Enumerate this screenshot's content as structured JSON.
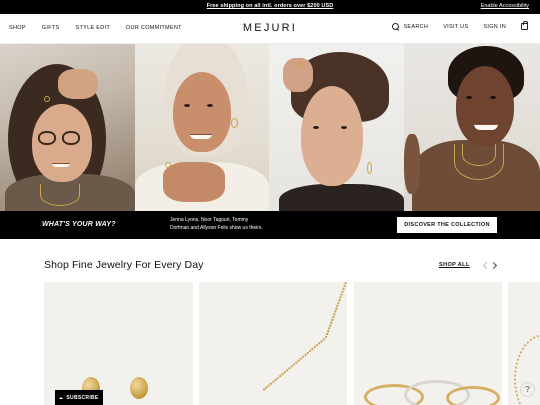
{
  "announcement": {
    "message": "Free shipping on all intl. orders over $200 USD",
    "accessibility_link": "Enable Accessibility"
  },
  "header": {
    "logo": "MEJURI",
    "nav_left": [
      "SHOP",
      "GIFTS",
      "STYLE EDIT",
      "OUR COMMITMENT"
    ],
    "search_label": "SEARCH",
    "visit_label": "VISIT US",
    "signin_label": "SIGN IN",
    "icons": {
      "search": "search-icon",
      "bag": "shopping-bag-icon"
    }
  },
  "hero": {
    "panels": [
      {
        "name": "model-with-glasses"
      },
      {
        "name": "model-with-headscarf"
      },
      {
        "name": "model-touching-hair"
      },
      {
        "name": "model-smiling"
      }
    ]
  },
  "promo": {
    "question": "WHAT'S YOUR WAY?",
    "description": "Jenna Lyons, Noor Tagouri, Tommy Dorfman and Allyson Felix show us theirs.",
    "cta_label": "DISCOVER THE COLLECTION"
  },
  "section": {
    "title": "Shop Fine Jewelry For Every Day",
    "shop_all_label": "SHOP ALL",
    "icons": {
      "prev": "chevron-left-icon",
      "next": "chevron-right-icon"
    }
  },
  "products": [
    {
      "name": "gold-dome-earrings"
    },
    {
      "name": "gold-chain-necklace"
    },
    {
      "name": "stacked-rings"
    },
    {
      "name": "beaded-gold-bracelet"
    }
  ],
  "subscribe": {
    "label": "SUBSCRIBE",
    "icon": "caret-up-icon"
  },
  "help": {
    "glyph": "?",
    "icon": "help-icon"
  },
  "colors": {
    "background": "#ffffff",
    "bar": "#000000",
    "card": "#f3f1ee",
    "gold": "#c9a44a"
  }
}
